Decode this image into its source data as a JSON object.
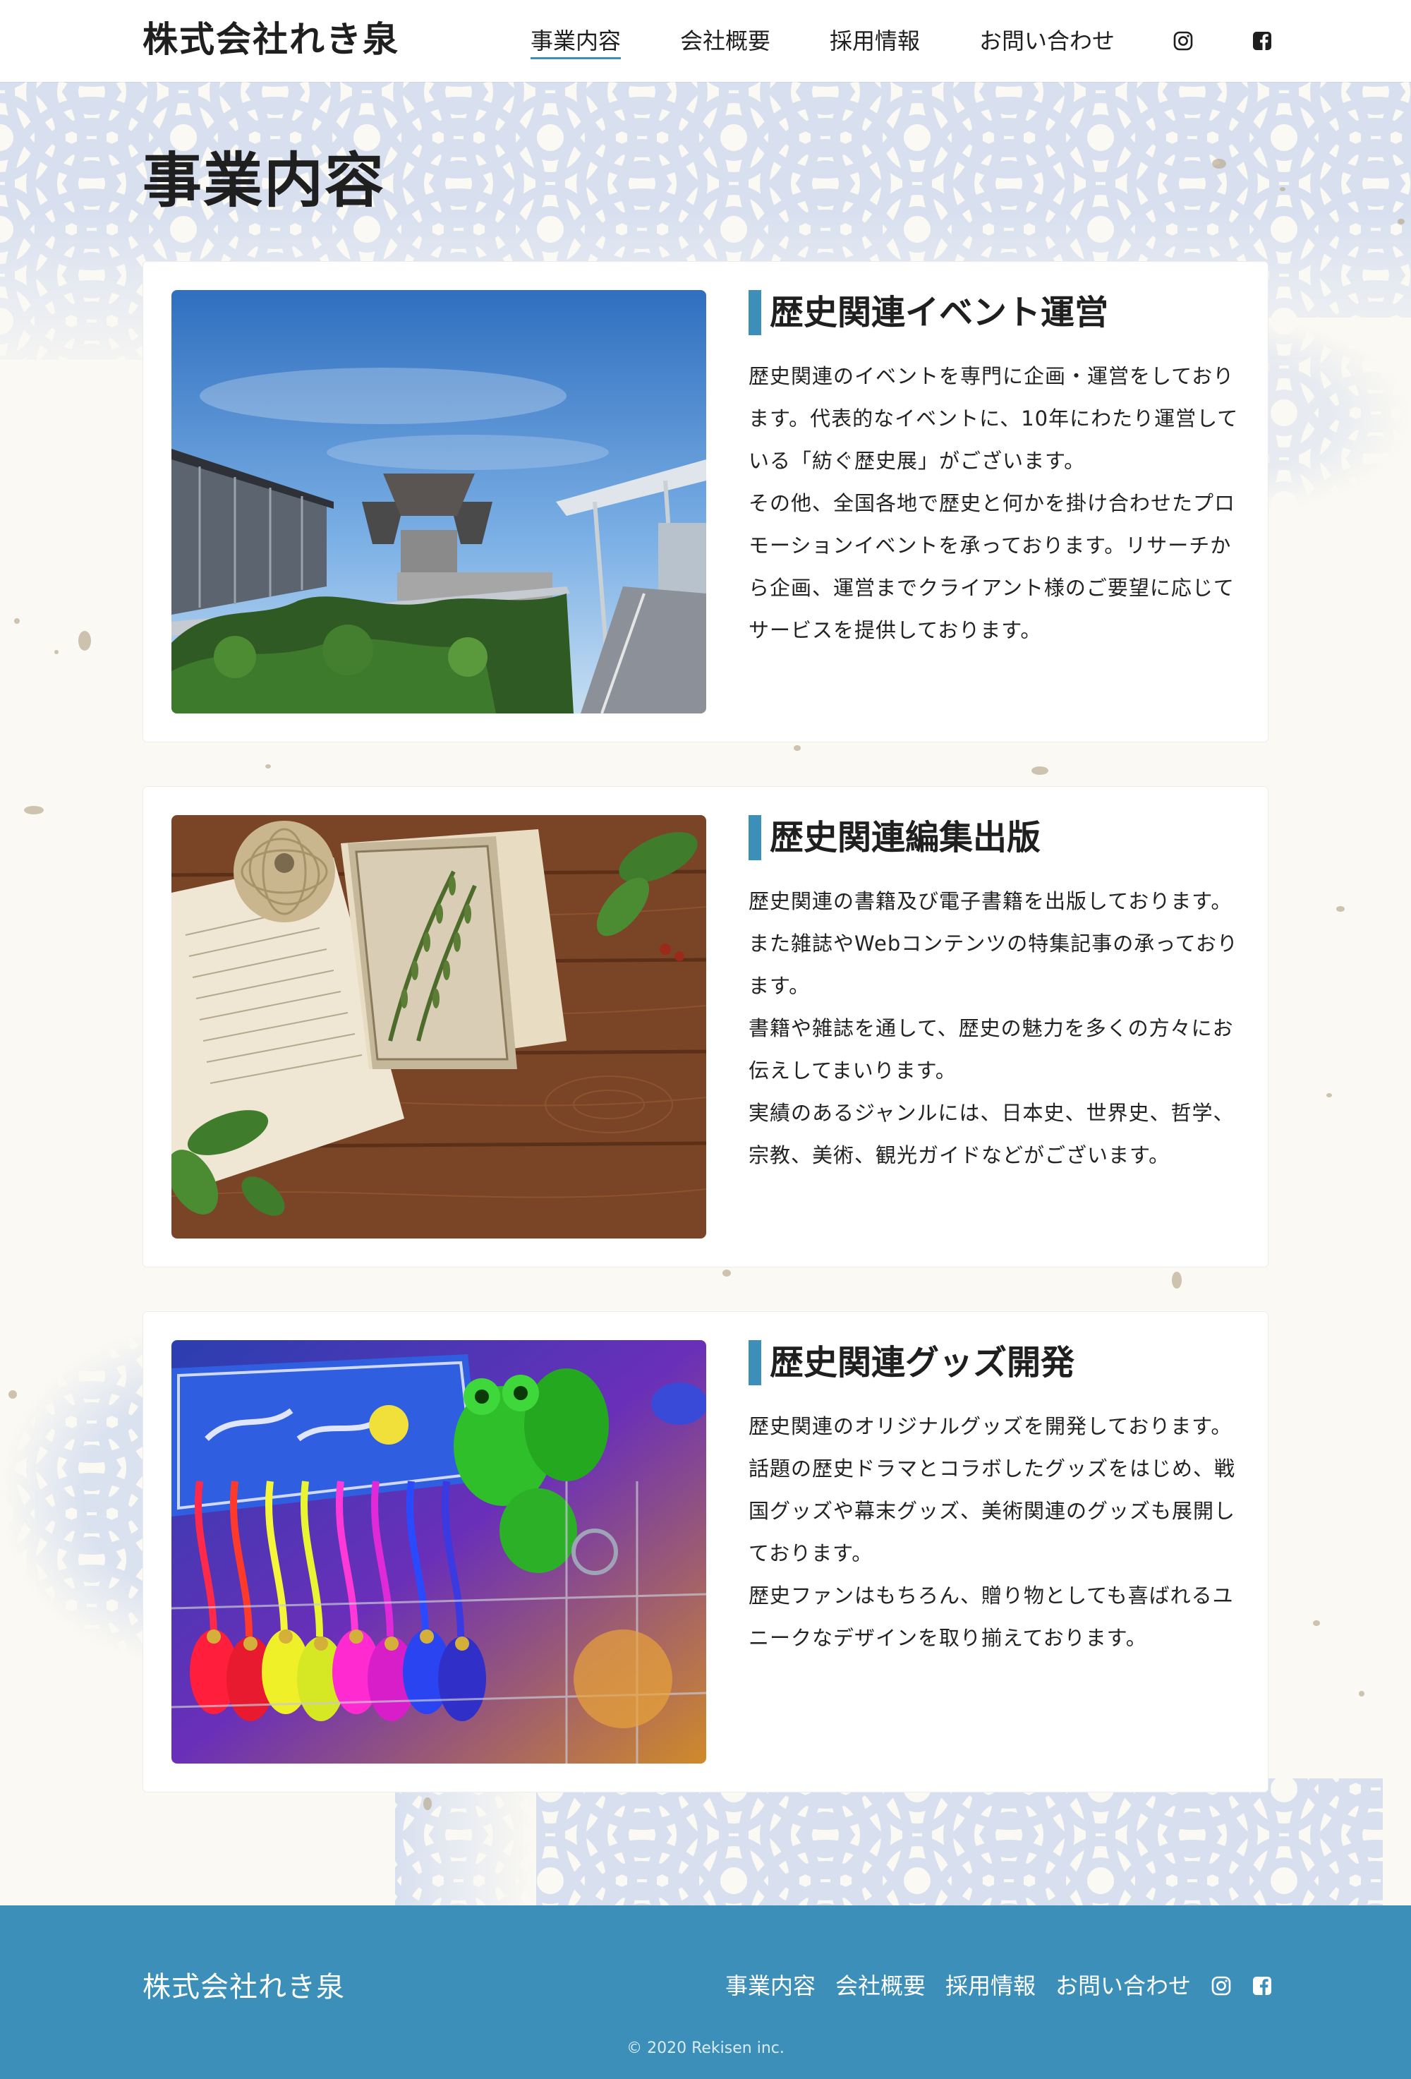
{
  "header": {
    "logo": "株式会社れき泉",
    "nav": [
      {
        "label": "事業内容",
        "active": true
      },
      {
        "label": "会社概要",
        "active": false
      },
      {
        "label": "採用情報",
        "active": false
      },
      {
        "label": "お問い合わせ",
        "active": false
      }
    ],
    "icons": [
      "instagram-icon",
      "facebook-icon"
    ]
  },
  "page": {
    "title": "事業内容"
  },
  "services": [
    {
      "title": "歴史関連イベント運営",
      "image": "exhibition-hall-photo",
      "paragraphs": [
        "歴史関連のイベントを専門に企画・運営をしております。代表的なイベントに、10年にわたり運営している「紡ぐ歴史展」がございます。",
        "その他、全国各地で歴史と何かを掛け合わせたプロモーションイベントを承っております。リサーチから企画、運営までクライアント様のご要望に応じてサービスを提供しております。"
      ]
    },
    {
      "title": "歴史関連編集出版",
      "image": "old-books-on-table-photo",
      "paragraphs": [
        "歴史関連の書籍及び電子書籍を出版しております。",
        "また雑誌やWebコンテンツの特集記事の承っております。",
        "書籍や雑誌を通して、歴史の魅力を多くの方々にお伝えしてまいります。",
        "実績のあるジャンルには、日本史、世界史、哲学、宗教、美術、観光ガイドなどがございます。"
      ]
    },
    {
      "title": "歴史関連グッズ開発",
      "image": "colorful-keychains-photo",
      "paragraphs": [
        "歴史関連のオリジナルグッズを開発しております。",
        "話題の歴史ドラマとコラボしたグッズをはじめ、戦国グッズや幕末グッズ、美術関連のグッズも展開しております。",
        "歴史ファンはもちろん、贈り物としても喜ばれるユニークなデザインを取り揃えております。"
      ]
    }
  ],
  "footer": {
    "logo": "株式会社れき泉",
    "nav": [
      "事業内容",
      "会社概要",
      "採用情報",
      "お問い合わせ"
    ],
    "copyright": "© 2020 Rekisen inc."
  },
  "colors": {
    "accent": "#3b8fb8",
    "background": "#fbf9f3",
    "text": "#222222"
  }
}
